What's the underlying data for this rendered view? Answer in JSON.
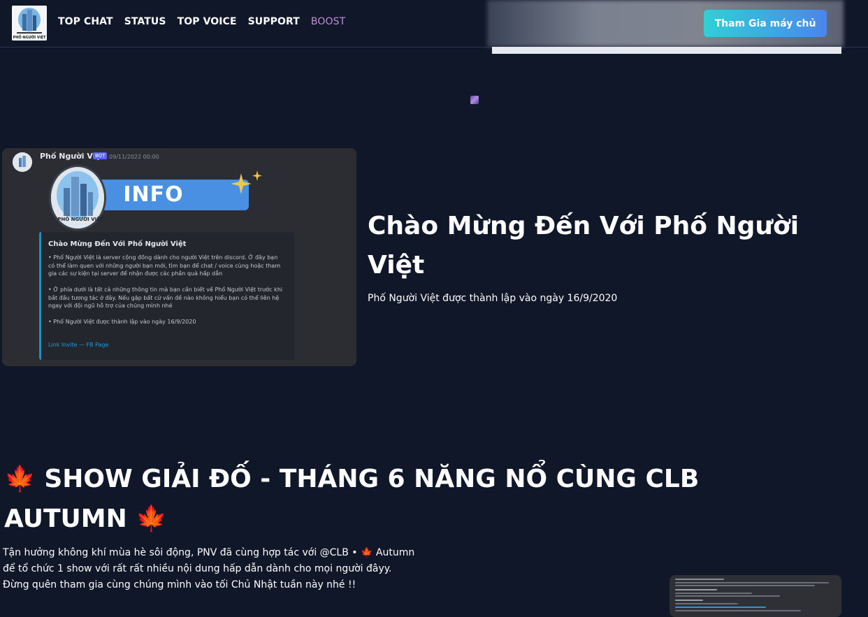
{
  "header": {
    "logo_text": "PHỐ NGƯỜI VIỆT",
    "nav": [
      {
        "label": "TOP CHAT"
      },
      {
        "label": "STATUS"
      },
      {
        "label": "TOP VOICE"
      },
      {
        "label": "SUPPORT"
      },
      {
        "label": "BOOST"
      }
    ],
    "join_button": "Tham Gia máy chủ"
  },
  "discord_card": {
    "author": "Phố Người Việt",
    "bot_tag": "BOT",
    "timestamp": "09/11/2022 00:00",
    "banner_text": "INFO",
    "logo_label": "PHỐ NGƯỜI VIỆT",
    "embed_title": "Chào Mừng Đến Với Phố Người Việt",
    "embed_body": "• Phố Người Việt là server cộng đồng dành cho người Việt trên discord. Ở đây bạn có thể làm quen với những người bạn mới, tìm bạn để chat / voice cùng hoặc tham gia các sự kiện tại server để nhận được các phần quà hấp dẫn\n\n• Ở phía dưới là tất cả những thông tin mà bạn cần biết về Phố Người Việt trước khi bắt đầu tương tác ở đây. Nếu gặp bất cứ vấn đề nào không hiểu bạn có thể liên hệ ngay với đội ngũ hỗ trợ của chúng mình nhé\n\n• Phố Người Việt được thành lập vào ngày 16/9/2020",
    "embed_links": "Link Invite — FB Page"
  },
  "hero": {
    "title": "Chào Mừng Đến Với Phố Người Việt",
    "subtitle": "Phố Người Việt được thành lập vào ngày 16/9/2020"
  },
  "event": {
    "title": "SHOW GIẢI ĐỐ - THÁNG 6 NĂNG NỔ CÙNG CLB AUTUMN",
    "emoji": "🍁",
    "body": "Tận hưởng không khí mùa hè sôi động, PNV đã cùng hợp tác với @CLB • 🍁 Autumn để tổ chức 1 show với rất rất nhiều nội dung hấp dẫn dành cho mọi người đâyy. Đừng quên tham gia cùng chúng mình vào tối Chủ Nhật tuần này nhé !!"
  },
  "colors": {
    "background": "#101729",
    "button_gradient_start": "#2fd0d8",
    "button_gradient_end": "#4a86ea",
    "boost": "#c38fd9",
    "embed_accent": "#1b8fd4"
  }
}
